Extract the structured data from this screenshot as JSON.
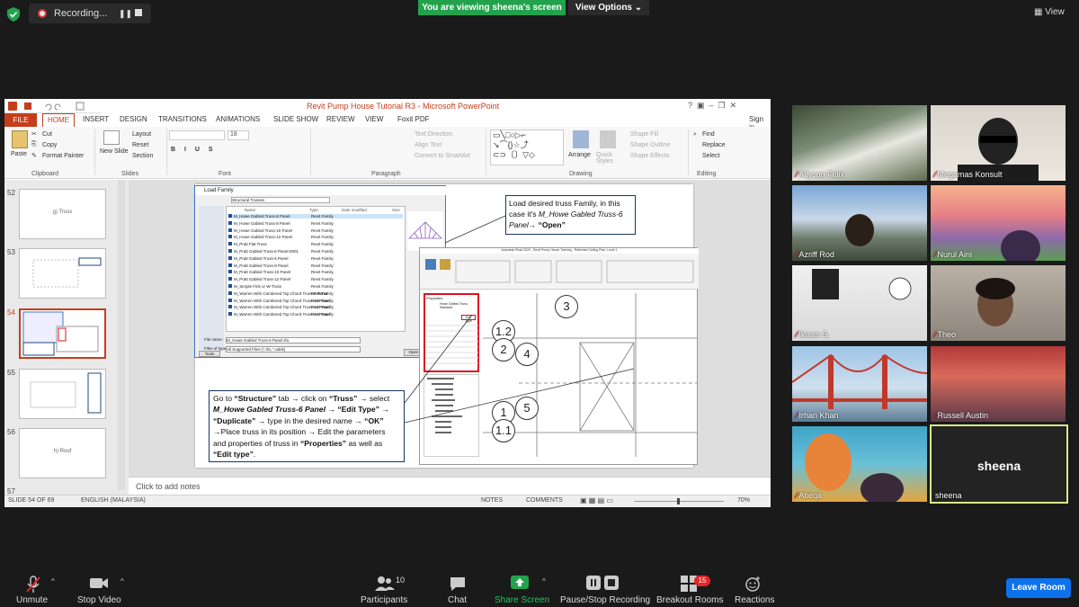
{
  "top": {
    "recording_label": "Recording...",
    "viewing_banner": "You are viewing sheena's screen",
    "view_options": "View Options",
    "view_button": "View"
  },
  "ppt": {
    "title": "Revit Pump House Tutorial R3 - Microsoft PowerPoint",
    "tabs": [
      "FILE",
      "HOME",
      "INSERT",
      "DESIGN",
      "TRANSITIONS",
      "ANIMATIONS",
      "SLIDE SHOW",
      "REVIEW",
      "VIEW",
      "Foxit PDF"
    ],
    "sign_in": "Sign in",
    "clipboard": {
      "paste": "Paste",
      "cut": "Cut",
      "copy": "Copy",
      "format_painter": "Format Painter",
      "group": "Clipboard"
    },
    "slides_group": {
      "new_slide": "New Slide",
      "layout": "Layout",
      "reset": "Reset",
      "section": "Section",
      "group": "Slides"
    },
    "font_group": {
      "size": "18",
      "group": "Font"
    },
    "paragraph_group": {
      "text_direction": "Text Direction",
      "align_text": "Align Text",
      "convert_smartart": "Convert to SmartArt",
      "group": "Paragraph"
    },
    "drawing_group": {
      "arrange": "Arrange",
      "quick_styles": "Quick Styles",
      "shape_fill": "Shape Fill",
      "shape_outline": "Shape Outline",
      "shape_effects": "Shape Effects",
      "group": "Drawing"
    },
    "editing_group": {
      "find": "Find",
      "replace": "Replace",
      "select": "Select",
      "group": "Editing"
    },
    "thumbnails": [
      {
        "num": "52",
        "label": "g) Truss"
      },
      {
        "num": "53",
        "label": ""
      },
      {
        "num": "54",
        "label": ""
      },
      {
        "num": "55",
        "label": ""
      },
      {
        "num": "56",
        "label": "h) Roof"
      },
      {
        "num": "57",
        "label": ""
      }
    ],
    "notes_placeholder": "Click to add notes",
    "status": {
      "slide": "SLIDE 54 OF 69",
      "language": "ENGLISH (MALAYSIA)",
      "notes": "NOTES",
      "comments": "COMMENTS",
      "zoom": "70%"
    }
  },
  "slide": {
    "dialog_title": "Load Family",
    "dialog_folder": "Structural Trusses",
    "dialog_cols": [
      "Name",
      "Type",
      "Date modified",
      "Size"
    ],
    "dialog_files": [
      "M_Howe Gabled Truss-6 Panel",
      "M_Howe Gabled Truss-8 Panel",
      "M_Howe Gabled Truss-10 Panel",
      "M_Howe Gabled Truss-12 Panel",
      "M_Pratt Flat Truss",
      "M_Pratt Gabled Truss-6 Panel-0001",
      "M_Pratt Gabled Truss-6 Panel",
      "M_Pratt Gabled Truss-8 Panel",
      "M_Pratt Gabled Truss-10 Panel",
      "M_Pratt Gabled Truss-12 Panel",
      "M_Simple Fink or W-Truss",
      "M_Warren With Cambered Top Chord Truss-8 Panel",
      "M_Warren With Cambered Top Chord Truss-10 Panel",
      "M_Warren With Cambered Top Chord Truss-12 Panel",
      "M_Warren With Cambered Top Chord Truss-14 Panel"
    ],
    "dialog_type": "Revit Family",
    "dialog_filename_label": "File name:",
    "dialog_filename": "M_Howe Gabled Truss-6 Panel.rfa",
    "dialog_filetype_label": "Files of type:",
    "dialog_filetype": "All Supported Files (*.rfa, *.adsk)",
    "dialog_open": "Open",
    "dialog_tools": "Tools",
    "revit_title": "Autodesk Revit 2020 - Revit Pump House Training - Reflected Ceiling Plan: Level 1",
    "props_title": "Properties",
    "props_type": "Howe Gabled Truss Standard",
    "edit_type": "Edit Type",
    "bubbles": [
      "3",
      "1.2",
      "2",
      "4",
      "1",
      "5",
      "1.1"
    ],
    "callout1": {
      "line1": "Load desired truss Family, in this case it's ",
      "italic": "M_Howe Gabled Truss-6 Panel",
      "arrow": "→ ",
      "open": "“Open”"
    },
    "callout2": {
      "p1": "Go to ",
      "structure": "“Structure”",
      "p2": " tab → click on ",
      "truss": "“Truss”",
      "p3": " → select ",
      "howe": "M_Howe Gabled Truss-6 Panel",
      "p4": " → ",
      "edit_type": "“Edit Type”",
      "p5": " → ",
      "duplicate": "“Duplicate”",
      "p6": " → type in the desired name → ",
      "ok": "“OK”",
      "p7": " →Place truss in its position → Edit the parameters and properties of truss in ",
      "properties": "“Properties”",
      "p8": " as well as ",
      "edit_type2": "“Edit type”",
      "p9": "."
    }
  },
  "participants": [
    {
      "name": "Allyson Felix",
      "muted": true
    },
    {
      "name": "Megamas Konsult",
      "muted": true
    },
    {
      "name": "Azriff Rod",
      "muted": true
    },
    {
      "name": "Nurul Aini",
      "muted": true
    },
    {
      "name": "Ikwan S.",
      "muted": true
    },
    {
      "name": "Theo",
      "muted": true
    },
    {
      "name": "Irhan Khan",
      "muted": true
    },
    {
      "name": "Russell Austin",
      "muted": true
    },
    {
      "name": "Atieqa",
      "muted": true
    },
    {
      "name": "sheena",
      "muted": false
    }
  ],
  "toolbar": {
    "unmute": "Unmute",
    "stop_video": "Stop Video",
    "participants": "Participants",
    "participants_count": "10",
    "chat": "Chat",
    "share_screen": "Share Screen",
    "pause_stop": "Pause/Stop Recording",
    "breakout": "Breakout Rooms",
    "breakout_badge": "15",
    "reactions": "Reactions",
    "leave": "Leave Room"
  },
  "colors": {
    "zoom_green": "#23a24d",
    "ppt_red": "#c43e1c",
    "leave_blue": "#0e72ed",
    "speaker_border": "#d7e98b",
    "revit_red": "#dd1122"
  }
}
